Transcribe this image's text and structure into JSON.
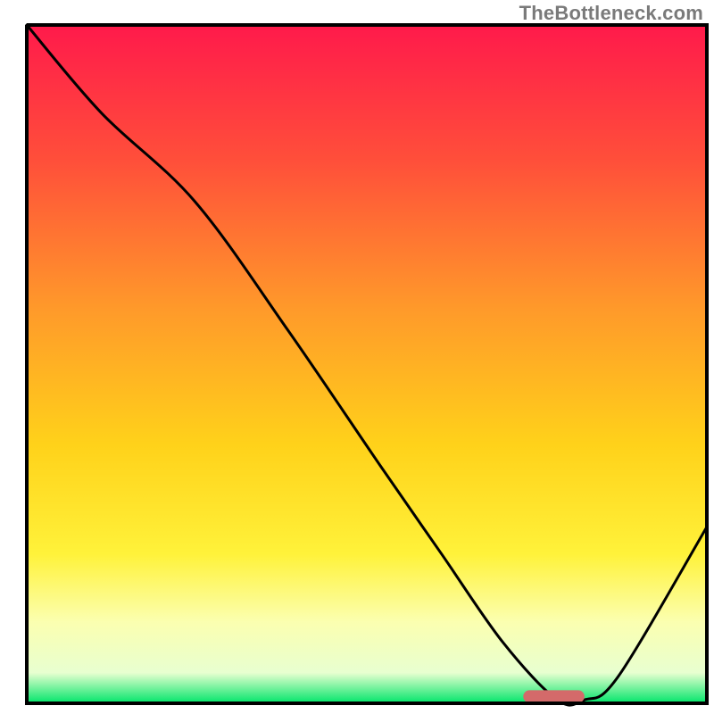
{
  "watermark": "TheBottleneck.com",
  "chart_data": {
    "type": "line",
    "title": "",
    "xlabel": "",
    "ylabel": "",
    "xlim": [
      0,
      100
    ],
    "ylim": [
      0,
      100
    ],
    "grid": false,
    "legend": false,
    "background_gradient": {
      "stops": [
        {
          "offset": 0.0,
          "color": "#ff1a4b"
        },
        {
          "offset": 0.2,
          "color": "#ff4f3a"
        },
        {
          "offset": 0.42,
          "color": "#ff9a2a"
        },
        {
          "offset": 0.62,
          "color": "#ffd21a"
        },
        {
          "offset": 0.78,
          "color": "#fff23a"
        },
        {
          "offset": 0.88,
          "color": "#fbffb0"
        },
        {
          "offset": 0.955,
          "color": "#e8ffd0"
        },
        {
          "offset": 1.0,
          "color": "#00e56a"
        }
      ]
    },
    "series": [
      {
        "name": "bottleneck-curve",
        "x": [
          0.0,
          11.0,
          24.7,
          38.4,
          52.0,
          61.0,
          70.0,
          78.0,
          82.0,
          87.0,
          100.0
        ],
        "y": [
          100.0,
          87.0,
          74.0,
          55.0,
          35.0,
          22.0,
          9.0,
          0.5,
          0.5,
          4.0,
          26.0
        ]
      }
    ],
    "marker": {
      "name": "optimal-range",
      "x_start": 73.0,
      "x_end": 82.0,
      "y": 1.0,
      "color": "#d46a6a"
    },
    "axes_color": "#000000",
    "axes_width": 4
  }
}
